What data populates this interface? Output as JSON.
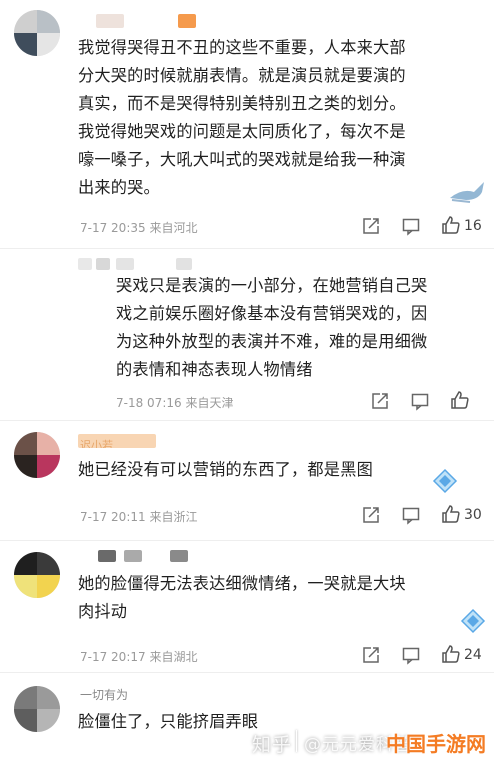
{
  "comments": [
    {
      "text_lines": [
        "我觉得哭得丑不丑的这些不重要，人本来大部",
        "分大哭的时候就崩表情。就是演员就是要演的",
        "真实，而不是哭得特别美特别丑之类的划分。",
        "我觉得她哭戏的问题是太同质化了，每次不是",
        "嚎一嗓子，大吼大叫式的哭戏就是给我一种演",
        "出来的哭。"
      ],
      "meta": "7-17 20:35 来自河北",
      "likes": "16"
    },
    {
      "text_lines": [
        "哭戏只是表演的一小部分，在她营销自己哭",
        "戏之前娱乐圈好像基本没有营销哭戏的，因",
        "为这种外放型的表演并不难，难的是用细微",
        "的表情和神态表现人物情绪"
      ],
      "meta": "7-18 07:16 来自天津",
      "likes": ""
    },
    {
      "name_partial": "迟小若",
      "text_lines": [
        "她已经没有可以营销的东西了，都是黑图"
      ],
      "meta": "7-17 20:11 来自浙江",
      "likes": "30"
    },
    {
      "text_lines": [
        "她的脸僵得无法表达细微情绪，一哭就是大块",
        "肉抖动"
      ],
      "meta": "7-17 20:17 来自湖北",
      "likes": "24"
    },
    {
      "name_partial": "一切有为",
      "text_lines": [
        "脸僵住了，只能挤眉弄眼"
      ]
    }
  ],
  "watermark": {
    "left": "知乎",
    "middle": "@元元爱科普",
    "logo": "中国手游网"
  },
  "colors": {
    "like_icon": "#555555",
    "badge_blue": "#5aa8e6",
    "name_orange": "#f0a050"
  },
  "icons": [
    "share-icon",
    "comment-icon",
    "like-icon",
    "badge-icon"
  ]
}
